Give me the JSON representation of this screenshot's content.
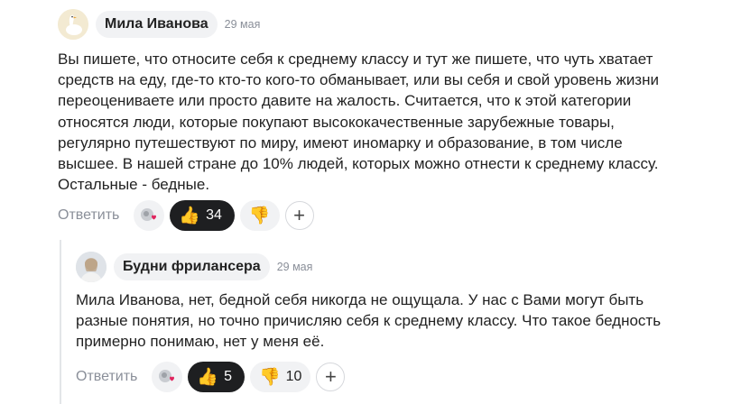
{
  "main_comment": {
    "author": "Мила Иванова",
    "date": "29 мая",
    "avatar_icon": "goose-icon",
    "text_lines": [
      "Вы пишете, что относите себя к среднему классу и тут же пишете, что чуть хватает",
      "средств на еду, где-то кто-то кого-то обманывает, или вы себя и свой уровень жизни",
      "переоцениваете или просто давите на жалость. Считается, что к этой категории",
      "относятся люди, которые покупают высококачественные зарубежные товары,",
      "регулярно путешествуют по миру, имеют иномарку и образование, в том числе",
      "высшее. В нашей стране до 10% людей, которых можно отнести к среднему классу.",
      "Остальные - бедные."
    ],
    "reply_label": "Ответить",
    "like_emoji": "👍",
    "like_count": "34",
    "dislike_emoji": "👎",
    "dislike_count": "",
    "add_label": "+"
  },
  "reply_comment": {
    "author": "Будни фрилансера",
    "date": "29 мая",
    "avatar_icon": "user-photo-avatar",
    "text_lines": [
      "Мила Иванова, нет, бедной себя никогда не ощущала. У нас с Вами могут быть",
      "разные понятия, но точно причисляю себя к среднему классу. Что такое бедность",
      "примерно понимаю, нет у меня её."
    ],
    "reply_label": "Ответить",
    "like_emoji": "👍",
    "like_count": "5",
    "dislike_emoji": "👎",
    "dislike_count": "10",
    "add_label": "+"
  },
  "colors": {
    "accent_dark": "#1e1f21",
    "pill_bg": "#f1f2f4",
    "muted_text": "#8a8f99",
    "thread_line": "#e3e5e8"
  }
}
